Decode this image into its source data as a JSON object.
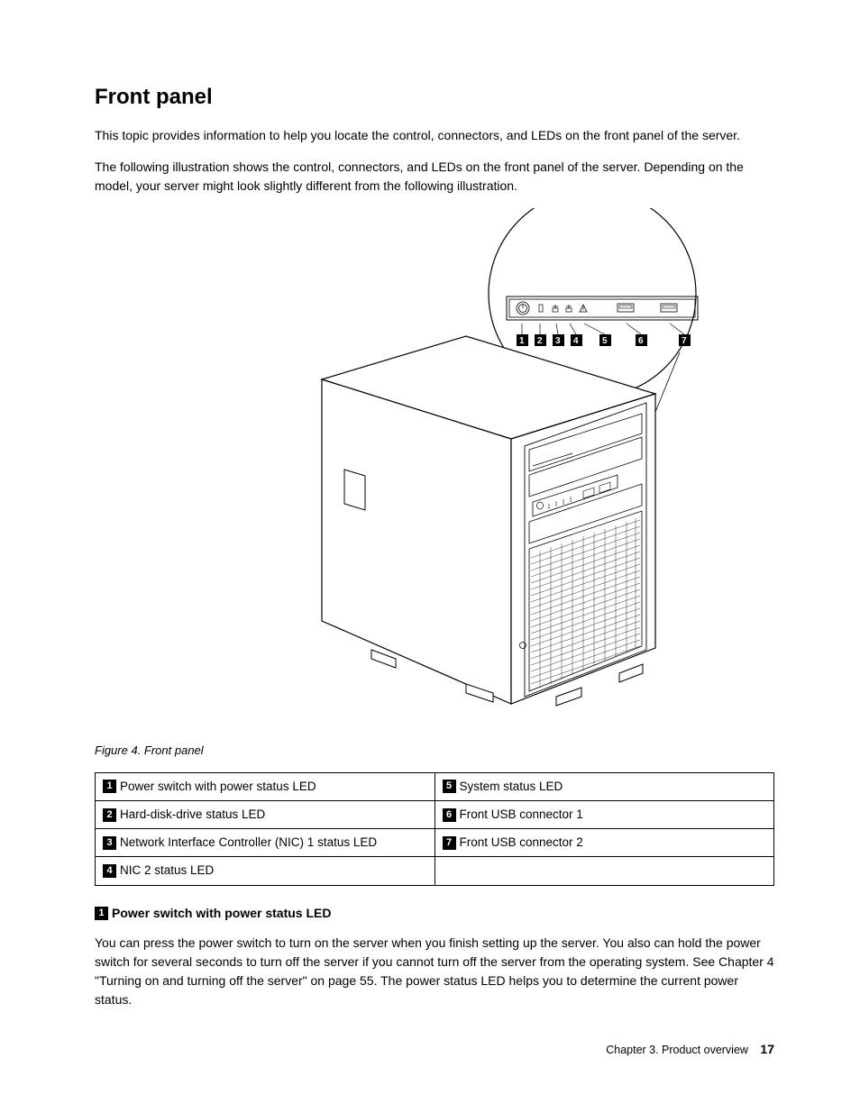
{
  "heading": "Front panel",
  "para1": "This topic provides information to help you locate the control, connectors, and LEDs on the front panel of the server.",
  "para2": "The following illustration shows the control, connectors, and LEDs on the front panel of the server. Depending on the model, your server might look slightly different from the following illustration.",
  "figure_caption": "Figure 4.  Front panel",
  "callout_labels": [
    "1",
    "2",
    "3",
    "4",
    "5",
    "6",
    "7"
  ],
  "table": {
    "r1c1_num": "1",
    "r1c1_text": "Power switch with power status LED",
    "r1c2_num": "5",
    "r1c2_text": "System status LED",
    "r2c1_num": "2",
    "r2c1_text": "Hard-disk-drive status LED",
    "r2c2_num": "6",
    "r2c2_text": "Front USB connector 1",
    "r3c1_num": "3",
    "r3c1_text": "Network Interface Controller (NIC) 1 status LED",
    "r3c2_num": "7",
    "r3c2_text": "Front USB connector 2",
    "r4c1_num": "4",
    "r4c1_text": "NIC 2 status LED",
    "r4c2_text": ""
  },
  "section2_num": "1",
  "section2_title": "Power switch with power status LED",
  "para3": "You can press the power switch to turn on the server when you finish setting up the server. You also can hold the power switch for several seconds to turn off the server if you cannot turn off the server from the operating system. See Chapter 4 \"Turning on and turning off the server\" on page 55. The power status LED helps you to determine the current power status.",
  "footer_chapter": "Chapter 3.  Product overview",
  "footer_page": "17"
}
